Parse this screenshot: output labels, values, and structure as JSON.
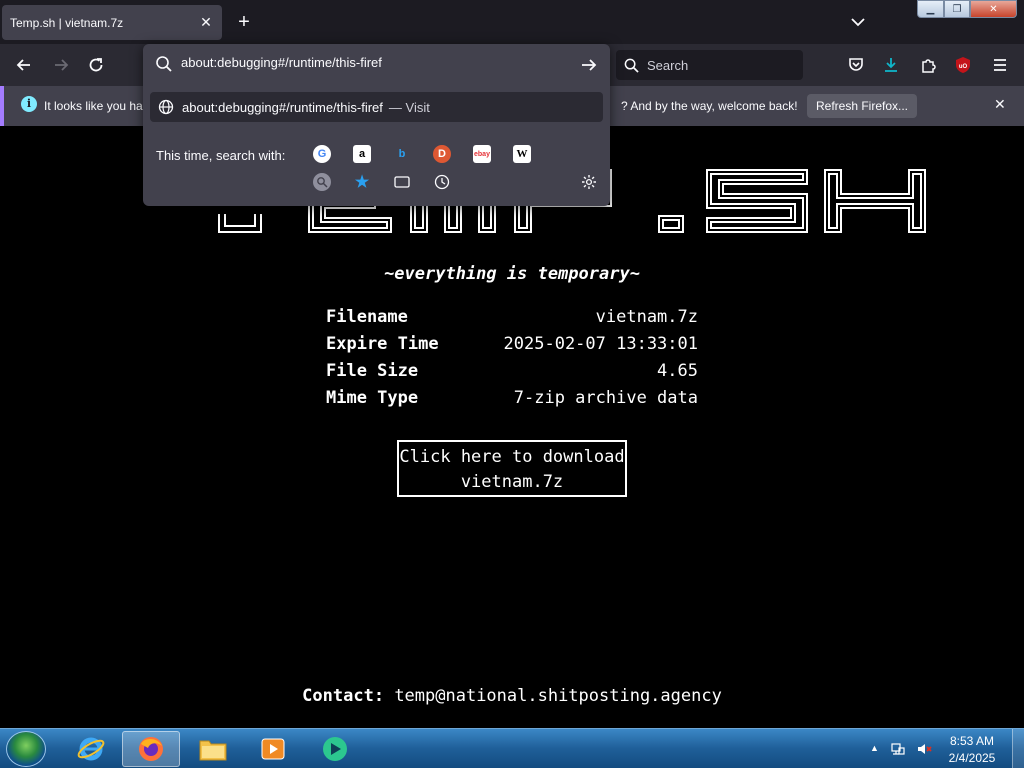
{
  "tab": {
    "title": "Temp.sh | vietnam.7z"
  },
  "urlbar": {
    "value": "about:debugging#/runtime/this-firef",
    "suggestion_url": "about:debugging#/runtime/this-firef",
    "suggestion_action": "— Visit",
    "search_with_label": "This time, search with:"
  },
  "navbar": {
    "search_placeholder": "Search"
  },
  "notification": {
    "text_left": "It looks like you ha",
    "text_right": "? And by the way, welcome back!",
    "refresh_label": "Refresh Firefox..."
  },
  "page": {
    "logo_text": "TEMP.SH",
    "tagline": "~everything is temporary~",
    "rows": [
      {
        "label": "Filename",
        "value": "vietnam.7z"
      },
      {
        "label": "Expire Time",
        "value": "2025-02-07 13:33:01"
      },
      {
        "label": "File Size",
        "value": "4.65"
      },
      {
        "label": "Mime Type",
        "value": "7-zip archive data"
      }
    ],
    "download_line1": "Click here to download",
    "download_line2": "vietnam.7z",
    "contact_label": "Contact:",
    "contact_email": "temp@national.shitposting.agency"
  },
  "taskbar": {
    "time": "8:53 AM",
    "date": "2/4/2025"
  },
  "colors": {
    "accent_purple": "#a47cff",
    "info_blue": "#80ebff",
    "download_teal": "#0fb5c8",
    "ublock_red": "#c4141a"
  }
}
